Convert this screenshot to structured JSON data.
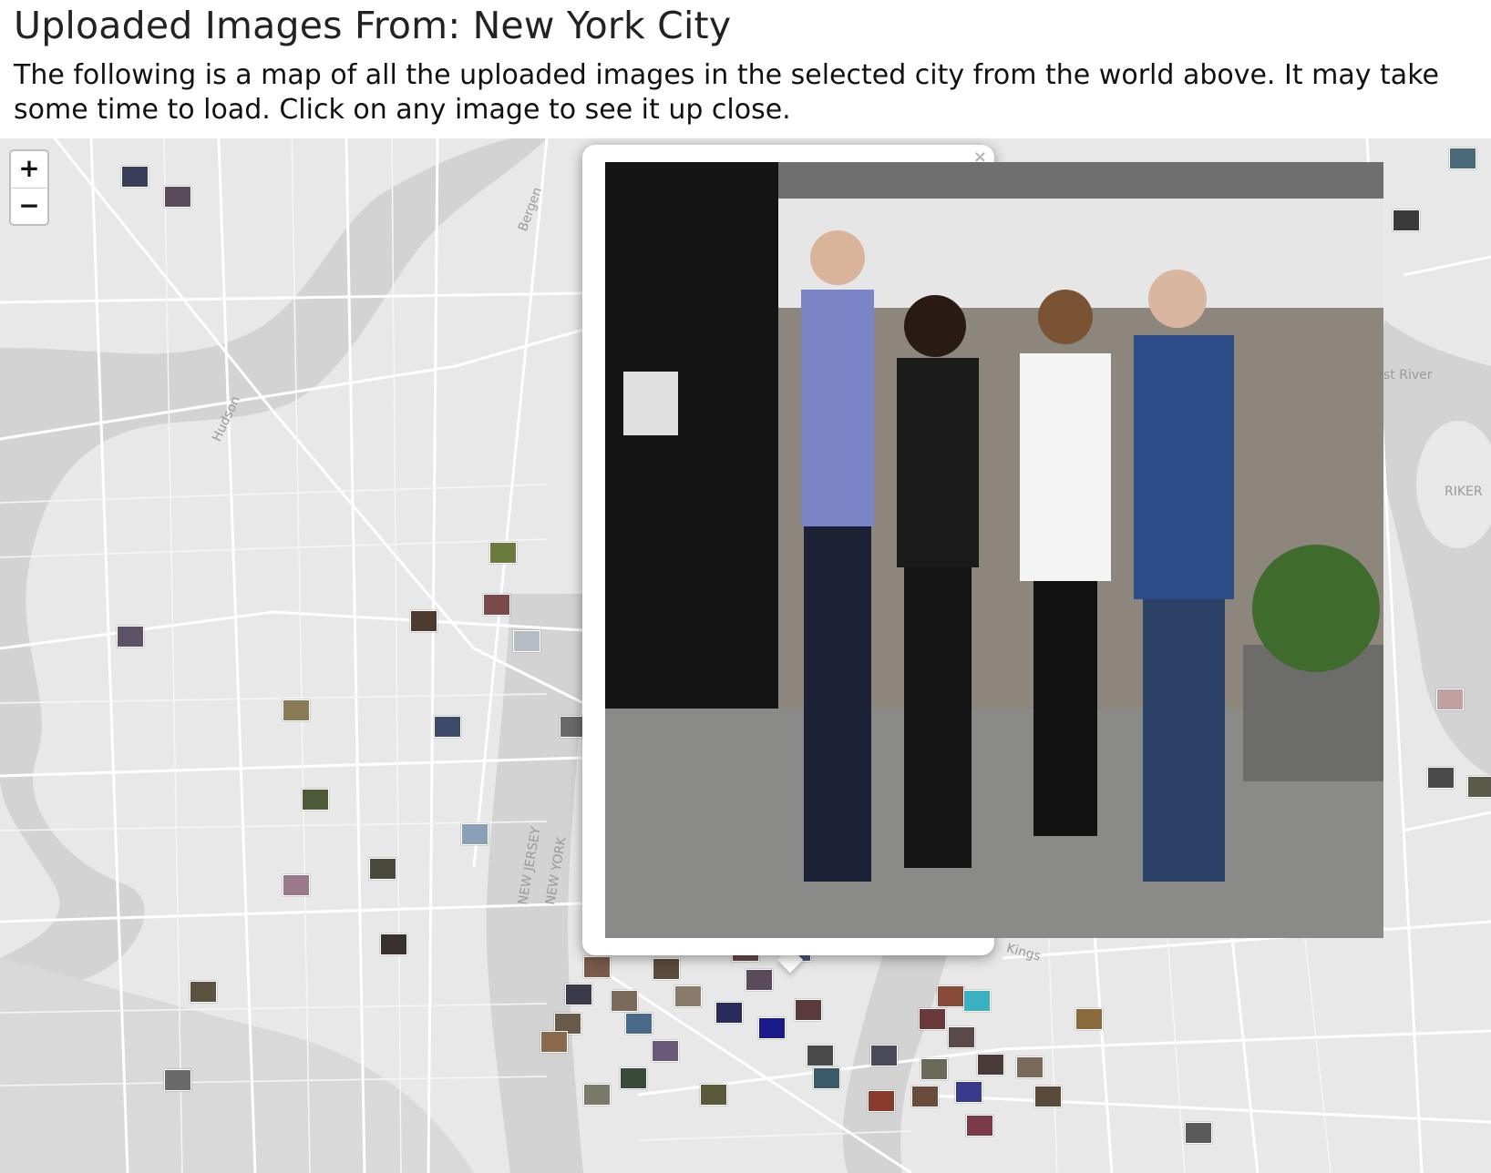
{
  "header": {
    "title": "Uploaded Images From: New York City",
    "description": "The following is a map of all the uploaded images in the selected city from the world above. It may take some time to load. Click on any image to see it up close."
  },
  "map": {
    "zoom_in_label": "+",
    "zoom_out_label": "−",
    "labels": {
      "hudson": "Hudson",
      "bergen": "Bergen",
      "east_river": "st River",
      "rikers": "RIKER",
      "new_jersey": "NEW JERSEY",
      "new_york": "NEW YORK",
      "kings": "Kings"
    }
  },
  "popup": {
    "close_label": "×"
  },
  "colors": {
    "map_land": "#e8e8e8",
    "map_water": "#d3d3d3",
    "map_road": "#ffffff",
    "zoom_border": "rgba(0,0,0,0.25)"
  }
}
